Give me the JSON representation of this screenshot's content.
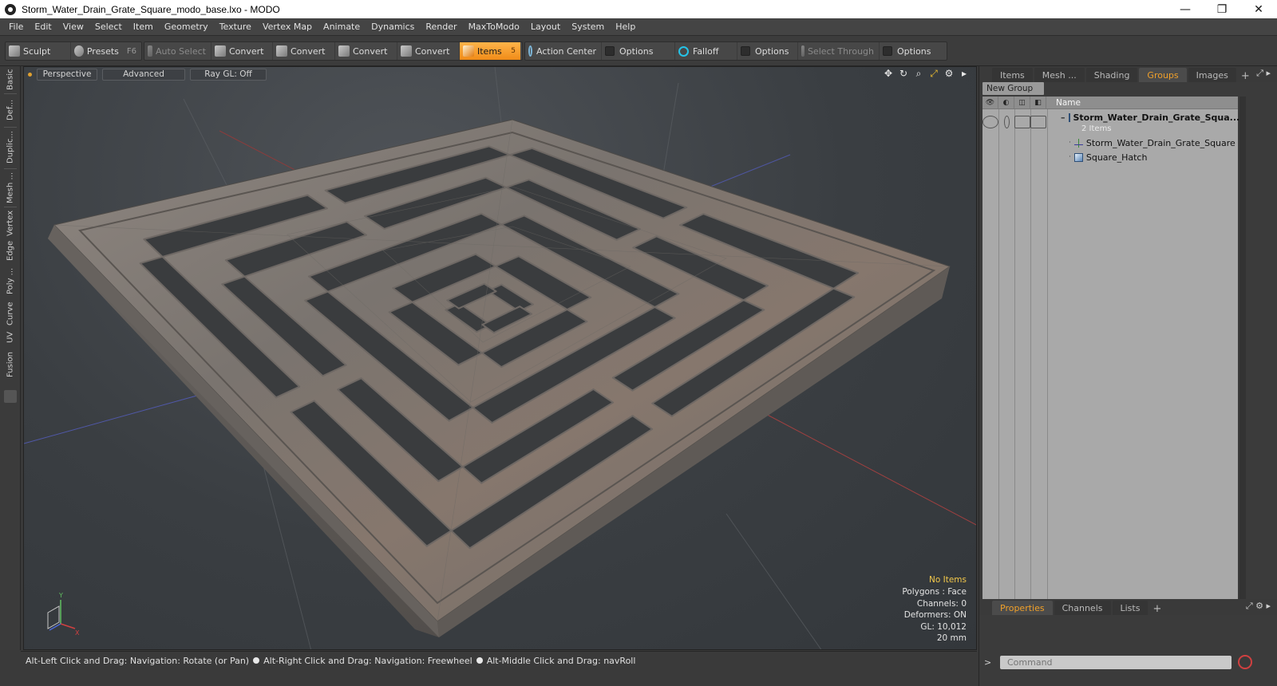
{
  "window": {
    "title": "Storm_Water_Drain_Grate_Square_modo_base.lxo - MODO",
    "minimize": "—",
    "restore": "❐",
    "close": "✕"
  },
  "menu": [
    "File",
    "Edit",
    "View",
    "Select",
    "Item",
    "Geometry",
    "Texture",
    "Vertex Map",
    "Animate",
    "Dynamics",
    "Render",
    "MaxToModo",
    "Layout",
    "System",
    "Help"
  ],
  "toolbar": {
    "sculpt": "Sculpt",
    "presets": "Presets",
    "presets_key": "F6",
    "auto_select": "Auto Select",
    "convert1": "Convert",
    "convert2": "Convert",
    "convert3": "Convert",
    "convert4": "Convert",
    "items": "Items",
    "items_count": "5",
    "action_center": "Action Center",
    "options1": "Options",
    "falloff": "Falloff",
    "options2": "Options",
    "select_through": "Select Through",
    "options3": "Options"
  },
  "left_tabs": [
    "Basic",
    "Def...",
    "Duplic...",
    "Mesh ...",
    "Vertex",
    "Edge",
    "Poly ...",
    "Curve",
    "UV",
    "Fusion"
  ],
  "viewport": {
    "view": "Perspective",
    "shading": "Advanced",
    "raygl": "Ray GL: Off",
    "info": {
      "items": "No Items",
      "polygons": "Polygons : Face",
      "channels": "Channels: 0",
      "deformers": "Deformers: ON",
      "gl": "GL: 10,012",
      "unit": "20 mm"
    }
  },
  "status": {
    "hint1": "Alt-Left Click and Drag: Navigation: Rotate (or Pan)",
    "hint2": "Alt-Right Click and Drag: Navigation: Freewheel",
    "hint3": "Alt-Middle Click and Drag: navRoll"
  },
  "right_panel": {
    "tabs": [
      "Items",
      "Mesh ...",
      "Shading",
      "Groups",
      "Images"
    ],
    "active_tab": "Groups",
    "new_group": "New Group",
    "name_col": "Name",
    "tree": {
      "group_name": "Storm_Water_Drain_Grate_Squa...",
      "group_count": "2 Items",
      "child1": "Storm_Water_Drain_Grate_Square",
      "child2": "Square_Hatch"
    },
    "bottom_tabs": [
      "Properties",
      "Channels",
      "Lists"
    ],
    "bottom_active": "Properties",
    "command_placeholder": "Command"
  },
  "colors": {
    "accent": "#f0a02a",
    "viewport_bg": "#3a3e42",
    "grate": "#7b7570"
  }
}
